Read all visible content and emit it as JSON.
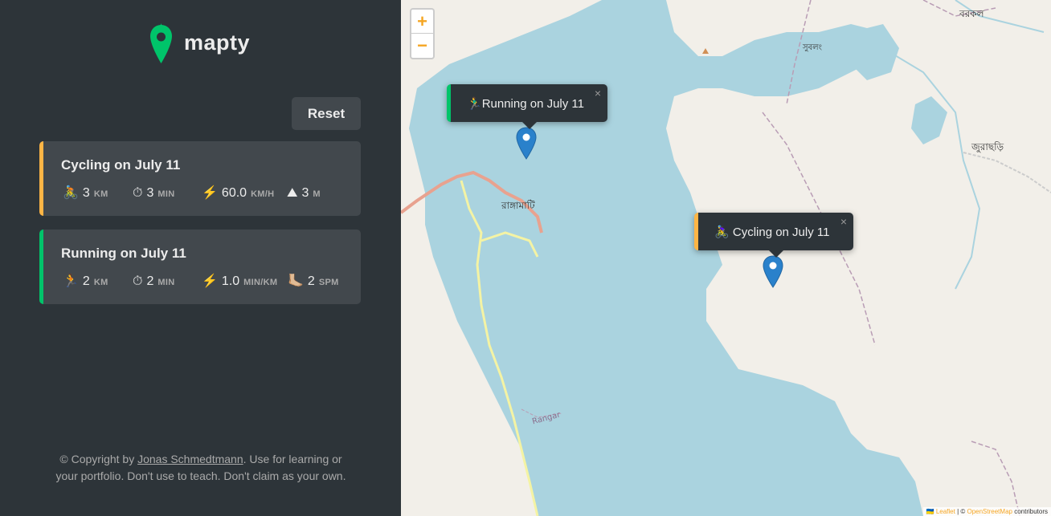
{
  "app": {
    "name": "mapty",
    "logo_icon": "map-pin-icon",
    "accent_cycling": "#ffb545",
    "accent_running": "#00c46a"
  },
  "sidebar": {
    "reset_label": "Reset",
    "workouts": [
      {
        "type": "cycling",
        "title": "Cycling on July 11",
        "details": [
          {
            "icon": "🚴",
            "icon_name": "cycling-icon",
            "value": "3",
            "unit": "km"
          },
          {
            "icon": "⏱",
            "icon_name": "stopwatch-icon",
            "value": "3",
            "unit": "min"
          },
          {
            "icon": "⚡️",
            "icon_name": "lightning-icon",
            "value": "60.0",
            "unit": "km/h"
          },
          {
            "icon": "⛰",
            "icon_name": "mountain-icon",
            "value": "3",
            "unit": "m"
          }
        ]
      },
      {
        "type": "running",
        "title": "Running on July 11",
        "details": [
          {
            "icon": "🏃",
            "icon_name": "running-icon",
            "value": "2",
            "unit": "km"
          },
          {
            "icon": "⏱",
            "icon_name": "stopwatch-icon",
            "value": "2",
            "unit": "min"
          },
          {
            "icon": "⚡️",
            "icon_name": "lightning-icon",
            "value": "1.0",
            "unit": "min/km"
          },
          {
            "icon": "🦶🏼",
            "icon_name": "foot-icon",
            "value": "2",
            "unit": "spm"
          }
        ]
      }
    ],
    "copyright": {
      "prefix": "© Copyright by ",
      "author": "Jonas Schmedtmann",
      "suffix": ". Use for learning or your portfolio. Don't use to teach. Don't claim as your own."
    }
  },
  "map": {
    "zoom_in": "+",
    "zoom_out": "−",
    "labels": {
      "barkal": "বরকল",
      "subalong": "সুবলং",
      "jurachhari": "জুরাছড়ি",
      "rangamati": "রাঙ্গামাটি",
      "rangar": "Rangar"
    },
    "popups": {
      "running": {
        "icon": "🏃‍♂️",
        "text": "Running on July 11",
        "close": "×"
      },
      "cycling": {
        "icon": "🚴‍♀️",
        "text": "Cycling on July 11",
        "close": "×"
      }
    },
    "attribution": {
      "flag": "🇺🇦",
      "leaflet": "Leaflet",
      "separator": " | © ",
      "osm": "OpenStreetMap",
      "suffix": " contributors"
    }
  }
}
